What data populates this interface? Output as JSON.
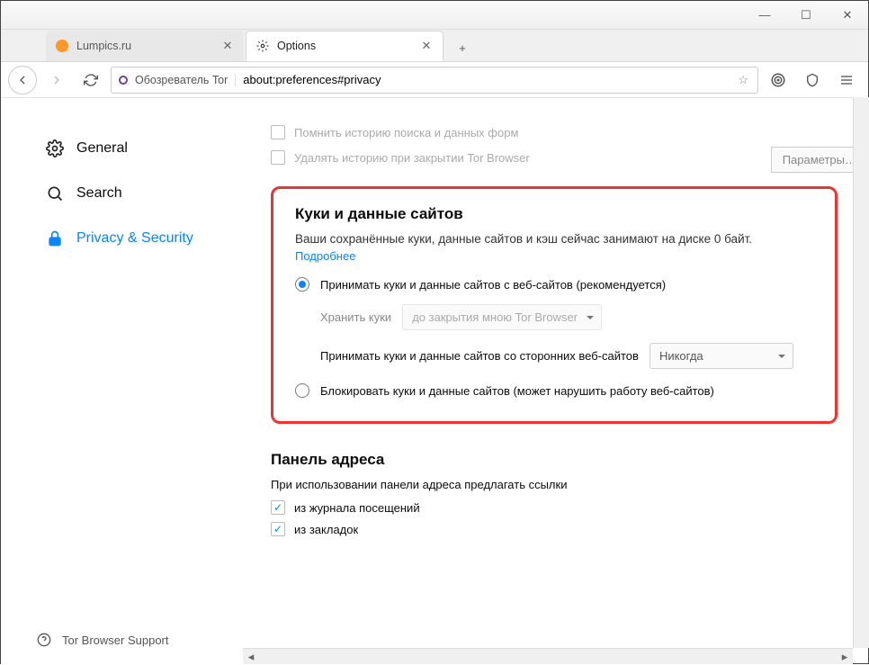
{
  "window": {
    "min": "—",
    "max": "☐",
    "close": "✕"
  },
  "tabs": [
    {
      "title": "Lumpics.ru",
      "favicon": "orange"
    },
    {
      "title": "Options",
      "favicon": "gear",
      "active": true
    }
  ],
  "newtab": "+",
  "nav": {
    "identity": "Обозреватель Tor",
    "url": "about:preferences#privacy"
  },
  "sidebar": {
    "general": "General",
    "search": "Search",
    "privacy": "Privacy & Security",
    "support": "Tor Browser Support"
  },
  "history": {
    "remember": "Помнить историю поиска и данных форм",
    "clear": "Удалять историю при закрытии Tor Browser",
    "params_btn": "Параметры…"
  },
  "cookies": {
    "heading": "Куки и данные сайтов",
    "desc": "Ваши сохранённые куки, данные сайтов и кэш сейчас занимают на диске 0 байт.",
    "learn_more": "Подробнее",
    "radio_accept": "Принимать куки и данные сайтов с веб-сайтов (рекомендуется)",
    "keep_label": "Хранить куки",
    "keep_value": "до закрытия мною Tor Browser",
    "third_party_label": "Принимать куки и данные сайтов со сторонних веб-сайтов",
    "third_party_value": "Никогда",
    "radio_block": "Блокировать куки и данные сайтов (может нарушить работу веб-сайтов)"
  },
  "addressbar": {
    "heading": "Панель адреса",
    "desc": "При использовании панели адреса предлагать ссылки",
    "history": "из журнала посещений",
    "bookmarks": "из закладок"
  }
}
